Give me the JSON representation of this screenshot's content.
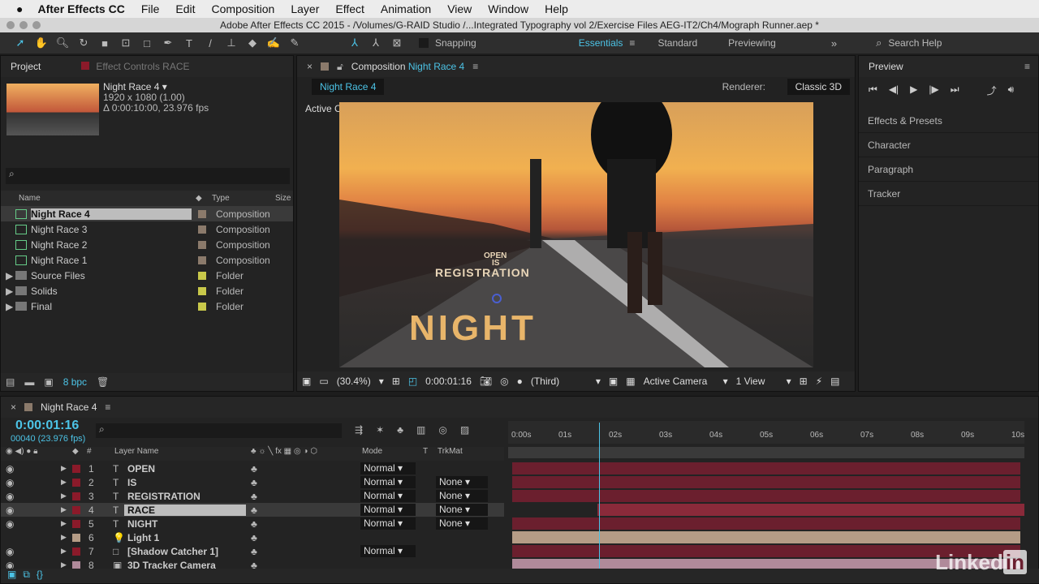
{
  "menubar": {
    "app": "After Effects CC",
    "items": [
      "File",
      "Edit",
      "Composition",
      "Layer",
      "Effect",
      "Animation",
      "View",
      "Window",
      "Help"
    ]
  },
  "titlebar": {
    "title": "Adobe After Effects CC 2015 - /Volumes/G-RAID Studio /...Integrated Typography vol 2/Exercise Files AEG-IT2/Ch4/Mograph Runner.aep *"
  },
  "toolbar": {
    "snapping": "Snapping",
    "workspaces": [
      "Essentials",
      "Standard",
      "Previewing"
    ],
    "active_workspace": "Essentials",
    "search_placeholder": "Search Help"
  },
  "project": {
    "tab": "Project",
    "effect_tab": "Effect Controls RACE",
    "item_name": "Night Race 4 ▾",
    "item_size": "1920 x 1080 (1.00)",
    "item_duration": "Δ 0:00:10:00, 23.976 fps",
    "columns": {
      "name": "Name",
      "type": "Type",
      "size": "Size"
    },
    "items": [
      {
        "name": "Night Race 4",
        "type": "Composition",
        "color": "#8b7a6b",
        "kind": "comp"
      },
      {
        "name": "Night Race 3",
        "type": "Composition",
        "color": "#8b7a6b",
        "kind": "comp"
      },
      {
        "name": "Night Race 2",
        "type": "Composition",
        "color": "#8b7a6b",
        "kind": "comp"
      },
      {
        "name": "Night Race 1",
        "type": "Composition",
        "color": "#8b7a6b",
        "kind": "comp"
      },
      {
        "name": "Source Files",
        "type": "Folder",
        "color": "#c8c84a",
        "kind": "folder"
      },
      {
        "name": "Solids",
        "type": "Folder",
        "color": "#c8c84a",
        "kind": "folder"
      },
      {
        "name": "Final",
        "type": "Folder",
        "color": "#c8c84a",
        "kind": "folder"
      }
    ],
    "bpc": "8 bpc"
  },
  "comp": {
    "tab_prefix": "Composition",
    "tab_name": "Night Race 4",
    "flow": "Night Race 4",
    "renderer_label": "Renderer:",
    "renderer": "Classic 3D",
    "view_label": "Active Camera",
    "text_open": "OPEN",
    "text_is": "IS",
    "text_registration": "REGISTRATION",
    "text_night": "NIGHT",
    "footer": {
      "zoom": "(30.4%)",
      "time": "0:00:01:16",
      "resolution": "(Third)",
      "camera": "Active Camera",
      "views": "1 View"
    }
  },
  "right": {
    "preview": "Preview",
    "panels": [
      "Effects & Presets",
      "Character",
      "Paragraph",
      "Tracker"
    ]
  },
  "timeline": {
    "tab": "Night Race 4",
    "timecode": "0:00:01:16",
    "frames": "00040 (23.976 fps)",
    "headers": {
      "num": "#",
      "name": "Layer Name",
      "mode": "Mode",
      "t": "T",
      "trkmat": "TrkMat"
    },
    "ruler": [
      "0:00s",
      "01s",
      "02s",
      "03s",
      "04s",
      "05s",
      "06s",
      "07s",
      "08s",
      "09s",
      "10s"
    ],
    "playhead_seconds": 1.67,
    "layers": [
      {
        "num": "1",
        "name": "OPEN",
        "icon": "T",
        "color": "#8b1a2a",
        "mode": "Normal",
        "trkmat": ""
      },
      {
        "num": "2",
        "name": "IS",
        "icon": "T",
        "color": "#8b1a2a",
        "mode": "Normal",
        "trkmat": "None"
      },
      {
        "num": "3",
        "name": "REGISTRATION",
        "icon": "T",
        "color": "#8b1a2a",
        "mode": "Normal",
        "trkmat": "None"
      },
      {
        "num": "4",
        "name": "RACE",
        "icon": "T",
        "color": "#8b1a2a",
        "mode": "Normal",
        "trkmat": "None",
        "selected": true
      },
      {
        "num": "5",
        "name": "NIGHT",
        "icon": "T",
        "color": "#8b1a2a",
        "mode": "Normal",
        "trkmat": "None"
      },
      {
        "num": "6",
        "name": "Light 1",
        "icon": "💡",
        "color": "#b59c86",
        "mode": "",
        "trkmat": ""
      },
      {
        "num": "7",
        "name": "[Shadow Catcher 1]",
        "icon": "□",
        "color": "#8b1a2a",
        "mode": "Normal",
        "trkmat": ""
      },
      {
        "num": "8",
        "name": "3D Tracker Camera",
        "icon": "▣",
        "color": "#b08a9a",
        "mode": "",
        "trkmat": ""
      }
    ]
  },
  "watermark": "LinkedIn"
}
